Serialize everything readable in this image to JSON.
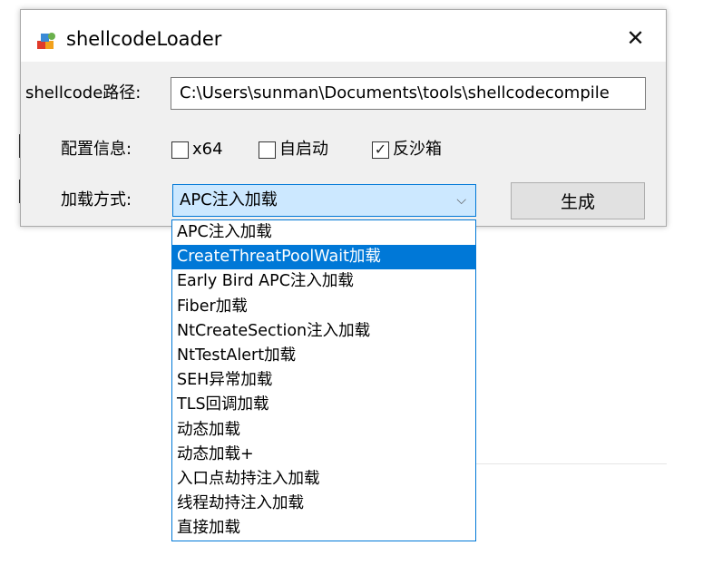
{
  "window": {
    "title": "shellcodeLoader",
    "close_glyph": "✕"
  },
  "form": {
    "path_label": "shellcode路径:",
    "path_value": "C:\\Users\\sunman\\Documents\\tools\\shellcodecompile",
    "config_label": "配置信息:",
    "load_label": "加载方式:",
    "checkboxes": [
      {
        "label": "x64",
        "checked": false
      },
      {
        "label": "自启动",
        "checked": false
      },
      {
        "label": "反沙箱",
        "checked": true
      }
    ],
    "select_value": "APC注入加载",
    "generate_label": "生成"
  },
  "dropdown": {
    "selected_index": 1,
    "options": [
      "APC注入加载",
      "CreateThreatPoolWait加载",
      "Early Bird APC注入加载",
      "Fiber加载",
      "NtCreateSection注入加载",
      "NtTestAlert加载",
      "SEH异常加载",
      "TLS回调加载",
      "动态加载",
      "动态加载+",
      "入口点劫持注入加载",
      "线程劫持注入加载",
      "直接加载"
    ]
  },
  "icons": {
    "app": "app-icon",
    "close": "close-icon",
    "chevron": "chevron-down-icon",
    "check": "checkmark-icon"
  },
  "colors": {
    "accent": "#0078d7",
    "select_bg": "#cce8ff",
    "window_bg": "#f0f0f0"
  }
}
